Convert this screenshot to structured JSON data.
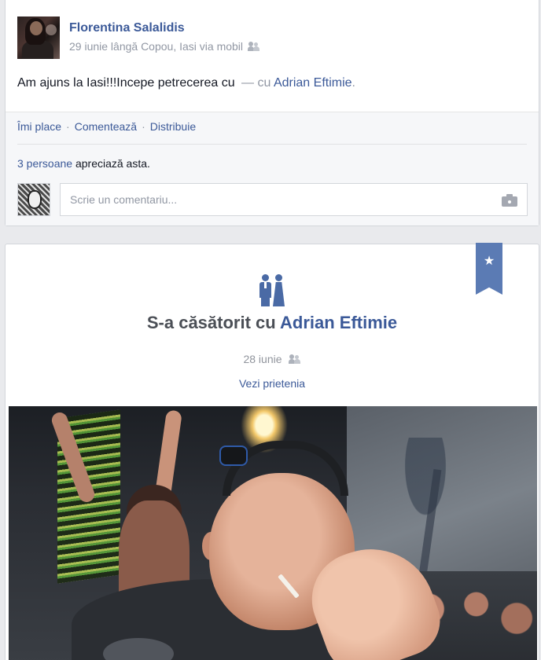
{
  "post": {
    "author": "Florentina Salalidis",
    "meta": "29 iunie lângă Copou, Iasi via mobil",
    "status_text": "Am ajuns la Iasi!!!Incepe petrecerea cu",
    "with_prefix": "— cu",
    "tagged_user": "Adrian Eftimie",
    "tagged_suffix": ".",
    "actions": {
      "like": "Îmi place",
      "comment": "Comentează",
      "share": "Distribuie",
      "separator": "·"
    },
    "likes": {
      "count_text": "3 persoane",
      "suffix": "apreciază asta."
    },
    "comment_placeholder": "Scrie un comentariu..."
  },
  "life_event": {
    "title_prefix": "S-a căsătorit cu",
    "partner": "Adrian Eftimie",
    "date": "28 iunie",
    "see_friendship": "Vezi prietenia",
    "bookmark_symbol": "★"
  },
  "colors": {
    "link": "#3b5998",
    "bookmark": "#5b7bb4",
    "background": "#e9eaed"
  },
  "icons": [
    "friends-icon",
    "camera-icon",
    "couple-icon",
    "star-icon"
  ]
}
